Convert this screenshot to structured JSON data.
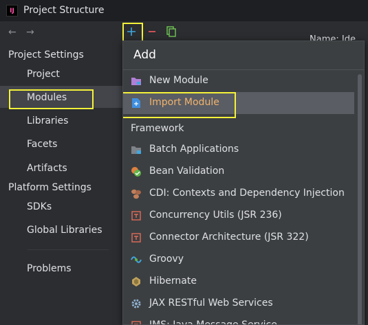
{
  "window": {
    "title": "Project Structure"
  },
  "sidebar": {
    "sections": [
      {
        "label": "Project Settings",
        "items": [
          "Project",
          "Modules",
          "Libraries",
          "Facets",
          "Artifacts"
        ]
      },
      {
        "label": "Platform Settings",
        "items": [
          "SDKs",
          "Global Libraries"
        ]
      }
    ],
    "problems": "Problems",
    "selected": "Modules"
  },
  "toolbar": {
    "add": "+",
    "remove": "−"
  },
  "right": {
    "name_text": "Name:  Ide"
  },
  "popup": {
    "title": "Add",
    "items": [
      {
        "label": "New Module",
        "icon": "folder-icon"
      },
      {
        "label": "Import Module",
        "icon": "import-module-icon"
      }
    ],
    "group": "Framework",
    "frameworks": [
      {
        "label": "Batch Applications",
        "icon": "batch-folder-icon"
      },
      {
        "label": "Bean Validation",
        "icon": "bean-validation-icon"
      },
      {
        "label": "CDI: Contexts and Dependency Injection",
        "icon": "cdi-icon"
      },
      {
        "label": "Concurrency Utils (JSR 236)",
        "icon": "jee-icon"
      },
      {
        "label": "Connector Architecture (JSR 322)",
        "icon": "jee-icon"
      },
      {
        "label": "Groovy",
        "icon": "groovy-icon"
      },
      {
        "label": "Hibernate",
        "icon": "hibernate-icon"
      },
      {
        "label": "JAX RESTful Web Services",
        "icon": "gear-icon"
      },
      {
        "label": "JMS: Java Message Service",
        "icon": "jee-icon"
      }
    ]
  },
  "colors": {
    "highlight": "#f5f23a",
    "selected_text": "#f0b36e",
    "add": "#3fa7e0",
    "remove": "#e0555b"
  }
}
